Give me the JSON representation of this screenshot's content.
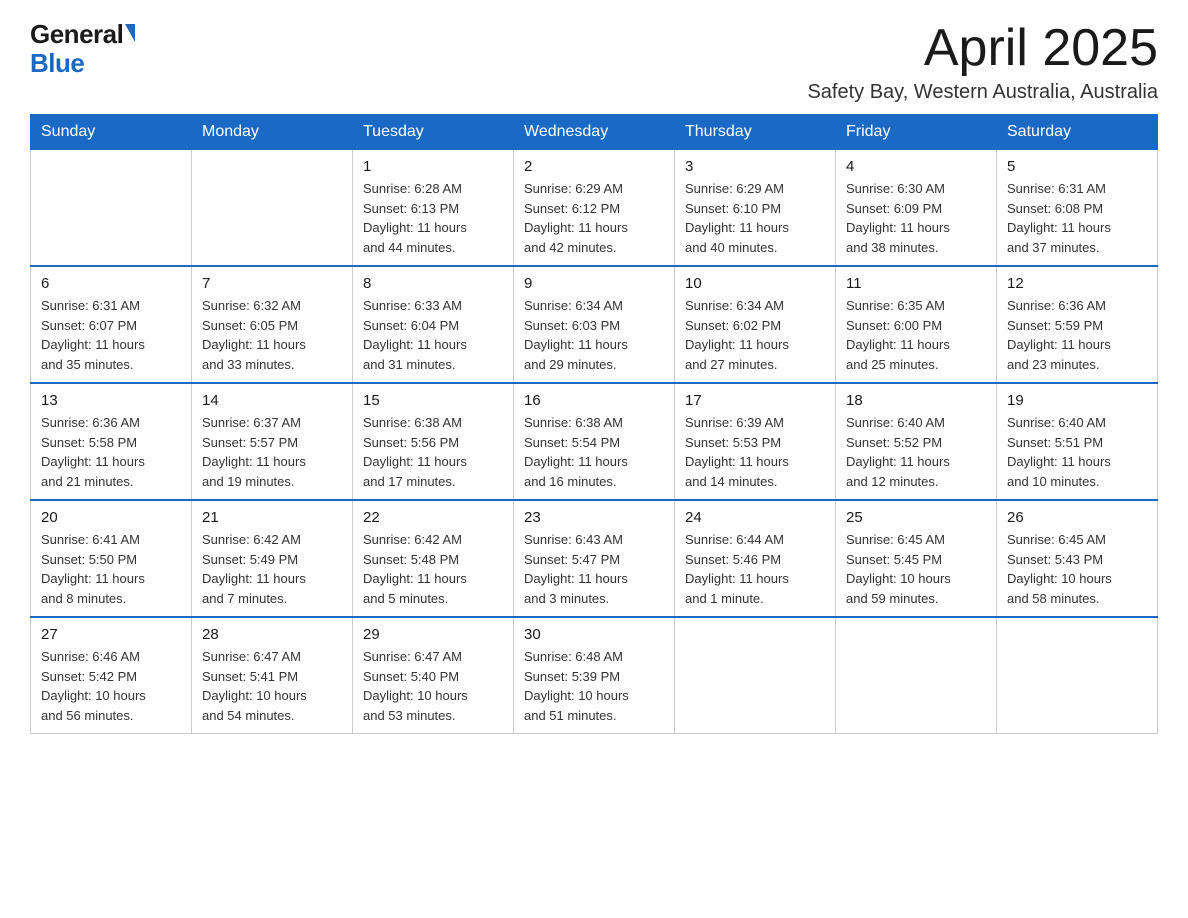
{
  "logo": {
    "general": "General",
    "blue": "Blue"
  },
  "title": "April 2025",
  "location": "Safety Bay, Western Australia, Australia",
  "days_of_week": [
    "Sunday",
    "Monday",
    "Tuesday",
    "Wednesday",
    "Thursday",
    "Friday",
    "Saturday"
  ],
  "weeks": [
    [
      {
        "day": "",
        "info": ""
      },
      {
        "day": "",
        "info": ""
      },
      {
        "day": "1",
        "info": "Sunrise: 6:28 AM\nSunset: 6:13 PM\nDaylight: 11 hours\nand 44 minutes."
      },
      {
        "day": "2",
        "info": "Sunrise: 6:29 AM\nSunset: 6:12 PM\nDaylight: 11 hours\nand 42 minutes."
      },
      {
        "day": "3",
        "info": "Sunrise: 6:29 AM\nSunset: 6:10 PM\nDaylight: 11 hours\nand 40 minutes."
      },
      {
        "day": "4",
        "info": "Sunrise: 6:30 AM\nSunset: 6:09 PM\nDaylight: 11 hours\nand 38 minutes."
      },
      {
        "day": "5",
        "info": "Sunrise: 6:31 AM\nSunset: 6:08 PM\nDaylight: 11 hours\nand 37 minutes."
      }
    ],
    [
      {
        "day": "6",
        "info": "Sunrise: 6:31 AM\nSunset: 6:07 PM\nDaylight: 11 hours\nand 35 minutes."
      },
      {
        "day": "7",
        "info": "Sunrise: 6:32 AM\nSunset: 6:05 PM\nDaylight: 11 hours\nand 33 minutes."
      },
      {
        "day": "8",
        "info": "Sunrise: 6:33 AM\nSunset: 6:04 PM\nDaylight: 11 hours\nand 31 minutes."
      },
      {
        "day": "9",
        "info": "Sunrise: 6:34 AM\nSunset: 6:03 PM\nDaylight: 11 hours\nand 29 minutes."
      },
      {
        "day": "10",
        "info": "Sunrise: 6:34 AM\nSunset: 6:02 PM\nDaylight: 11 hours\nand 27 minutes."
      },
      {
        "day": "11",
        "info": "Sunrise: 6:35 AM\nSunset: 6:00 PM\nDaylight: 11 hours\nand 25 minutes."
      },
      {
        "day": "12",
        "info": "Sunrise: 6:36 AM\nSunset: 5:59 PM\nDaylight: 11 hours\nand 23 minutes."
      }
    ],
    [
      {
        "day": "13",
        "info": "Sunrise: 6:36 AM\nSunset: 5:58 PM\nDaylight: 11 hours\nand 21 minutes."
      },
      {
        "day": "14",
        "info": "Sunrise: 6:37 AM\nSunset: 5:57 PM\nDaylight: 11 hours\nand 19 minutes."
      },
      {
        "day": "15",
        "info": "Sunrise: 6:38 AM\nSunset: 5:56 PM\nDaylight: 11 hours\nand 17 minutes."
      },
      {
        "day": "16",
        "info": "Sunrise: 6:38 AM\nSunset: 5:54 PM\nDaylight: 11 hours\nand 16 minutes."
      },
      {
        "day": "17",
        "info": "Sunrise: 6:39 AM\nSunset: 5:53 PM\nDaylight: 11 hours\nand 14 minutes."
      },
      {
        "day": "18",
        "info": "Sunrise: 6:40 AM\nSunset: 5:52 PM\nDaylight: 11 hours\nand 12 minutes."
      },
      {
        "day": "19",
        "info": "Sunrise: 6:40 AM\nSunset: 5:51 PM\nDaylight: 11 hours\nand 10 minutes."
      }
    ],
    [
      {
        "day": "20",
        "info": "Sunrise: 6:41 AM\nSunset: 5:50 PM\nDaylight: 11 hours\nand 8 minutes."
      },
      {
        "day": "21",
        "info": "Sunrise: 6:42 AM\nSunset: 5:49 PM\nDaylight: 11 hours\nand 7 minutes."
      },
      {
        "day": "22",
        "info": "Sunrise: 6:42 AM\nSunset: 5:48 PM\nDaylight: 11 hours\nand 5 minutes."
      },
      {
        "day": "23",
        "info": "Sunrise: 6:43 AM\nSunset: 5:47 PM\nDaylight: 11 hours\nand 3 minutes."
      },
      {
        "day": "24",
        "info": "Sunrise: 6:44 AM\nSunset: 5:46 PM\nDaylight: 11 hours\nand 1 minute."
      },
      {
        "day": "25",
        "info": "Sunrise: 6:45 AM\nSunset: 5:45 PM\nDaylight: 10 hours\nand 59 minutes."
      },
      {
        "day": "26",
        "info": "Sunrise: 6:45 AM\nSunset: 5:43 PM\nDaylight: 10 hours\nand 58 minutes."
      }
    ],
    [
      {
        "day": "27",
        "info": "Sunrise: 6:46 AM\nSunset: 5:42 PM\nDaylight: 10 hours\nand 56 minutes."
      },
      {
        "day": "28",
        "info": "Sunrise: 6:47 AM\nSunset: 5:41 PM\nDaylight: 10 hours\nand 54 minutes."
      },
      {
        "day": "29",
        "info": "Sunrise: 6:47 AM\nSunset: 5:40 PM\nDaylight: 10 hours\nand 53 minutes."
      },
      {
        "day": "30",
        "info": "Sunrise: 6:48 AM\nSunset: 5:39 PM\nDaylight: 10 hours\nand 51 minutes."
      },
      {
        "day": "",
        "info": ""
      },
      {
        "day": "",
        "info": ""
      },
      {
        "day": "",
        "info": ""
      }
    ]
  ]
}
